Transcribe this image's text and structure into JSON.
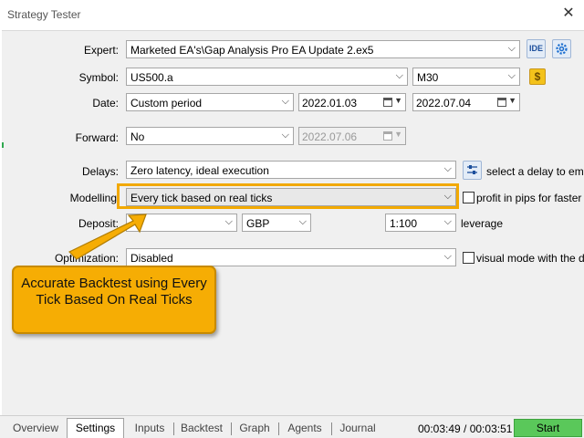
{
  "window": {
    "title": "Strategy Tester"
  },
  "settings": {
    "expert": {
      "label": "Expert:",
      "value": "Marketed EA's\\Gap Analysis Pro EA Update 2.ex5",
      "ide_label": "IDE"
    },
    "symbol": {
      "label": "Symbol:",
      "value": "US500.a",
      "timeframe": "M30",
      "coin_glyph": "$"
    },
    "date": {
      "label": "Date:",
      "period": "Custom period",
      "from": "2022.01.03",
      "to": "2022.07.04"
    },
    "forward": {
      "label": "Forward:",
      "value": "No",
      "date": "2022.07.06"
    },
    "delays": {
      "label": "Delays:",
      "value": "Zero latency, ideal execution",
      "side_text": "select a delay to emula"
    },
    "modelling": {
      "label": "Modelling",
      "value": "Every tick based on real ticks",
      "side_text": "profit in pips for faster calc"
    },
    "deposit": {
      "label": "Deposit:",
      "amount": "",
      "currency": "GBP",
      "leverage": "1:100",
      "leverage_label": "leverage"
    },
    "optimization": {
      "label": "Optimization:",
      "value": "Disabled",
      "side_text": "visual mode with the displ"
    }
  },
  "callout": {
    "text": "Accurate Backtest using Every Tick Based On Real Ticks",
    "color": "#f6ad04"
  },
  "tabs": [
    {
      "label": "Overview"
    },
    {
      "label": "Settings",
      "active": true
    },
    {
      "label": "Inputs"
    },
    {
      "label": "Backtest"
    },
    {
      "label": "Graph"
    },
    {
      "label": "Agents"
    },
    {
      "label": "Journal"
    }
  ],
  "status": {
    "timer": "00:03:49 / 00:03:51",
    "start_label": "Start",
    "start_color": "#5ac85a"
  },
  "icons": [
    "close-icon",
    "chevron-down-icon",
    "calendar-icon",
    "settings-gear-icon",
    "coin-icon",
    "delay-settings-icon"
  ]
}
